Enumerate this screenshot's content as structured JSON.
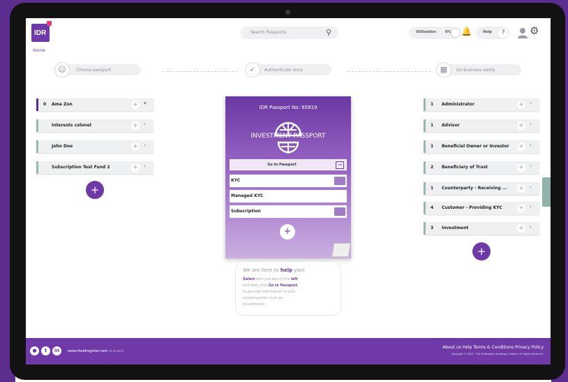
{
  "header": {
    "logo_text": "IDR",
    "home_link": "Home",
    "search_placeholder": "Search Passports",
    "utilisation_label": "Utilisation",
    "utilisation_value": "0%",
    "help_label": "Help",
    "help_symbol": "?"
  },
  "steps": [
    {
      "label": "Choose passport",
      "icon": "user-icon"
    },
    {
      "label": "Authenticate once",
      "icon": "check-icon"
    },
    {
      "label": "Do business easily",
      "icon": "network-icon"
    }
  ],
  "left_list": [
    {
      "num": "0",
      "label": "Ama Zon",
      "chev": "▾"
    },
    {
      "num": "",
      "label": "Interests colonel",
      "chev": "›"
    },
    {
      "num": "",
      "label": "John Doe",
      "chev": "›"
    },
    {
      "num": "",
      "label": "Subscription Test Fund 2",
      "chev": "›"
    }
  ],
  "passport": {
    "number": "IDR Passport No: 65819",
    "title": "INVESTMENT PASSPORT",
    "go_to": "Go to Passport",
    "rows": [
      "KYC",
      "Managed KYC",
      "Subscription"
    ]
  },
  "right_list": [
    {
      "num": "1",
      "label": "Administrator"
    },
    {
      "num": "1",
      "label": "Advisor"
    },
    {
      "num": "1",
      "label": "Beneficial Owner or Investor"
    },
    {
      "num": "2",
      "label": "Beneficiary of Trust"
    },
    {
      "num": "1",
      "label": "Counterparty - Receiving ..."
    },
    {
      "num": "4",
      "label": "Customer - Providing KYC"
    },
    {
      "num": "3",
      "label": "Investment"
    }
  ],
  "help_bubble": {
    "intro": "We are here to",
    "intro_bold": "help",
    "intro_end": "you!",
    "line1_a": "Select",
    "line1_b": "who you are on the",
    "line1_c": "left",
    "line2_a": "and then click",
    "line2_b": "Go to Passport",
    "line3": "to provide information to your",
    "line4": "counterparties such as",
    "line5": "investments."
  },
  "footer": {
    "url": "www.theidregister.com",
    "version": "(v.x.xxx)",
    "links": "About us  Help  Terms & Conditions  Privacy Policy",
    "copyright": "Copyright © 2022 · The ID Register (Holdings) Limited. All Rights Reserved."
  },
  "colors": {
    "brand": "#6f3aa8",
    "accent_bar": "#5b2d8f"
  }
}
